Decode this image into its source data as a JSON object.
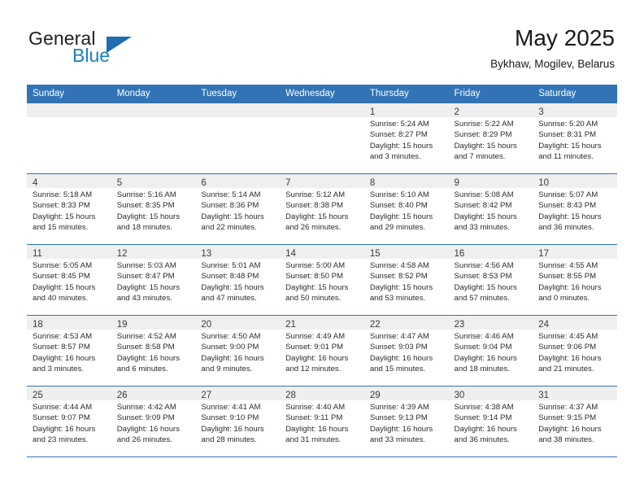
{
  "brand": {
    "word_one": "General",
    "word_two": "Blue",
    "triangle_color": "#1f6cb0",
    "blue_text_color": "#1a7fc1"
  },
  "header": {
    "month_title": "May 2025",
    "location": "Bykhaw, Mogilev, Belarus"
  },
  "theme": {
    "header_row_bg": "#3273b5",
    "header_row_text": "#ffffff",
    "daynum_strip_bg": "#efefef",
    "grid_line": "#3273b5"
  },
  "calendar": {
    "weekday_headers": [
      "Sunday",
      "Monday",
      "Tuesday",
      "Wednesday",
      "Thursday",
      "Friday",
      "Saturday"
    ],
    "weeks": [
      [
        {
          "day": "",
          "empty": true
        },
        {
          "day": "",
          "empty": true
        },
        {
          "day": "",
          "empty": true
        },
        {
          "day": "",
          "empty": true
        },
        {
          "day": "1",
          "sunrise": "Sunrise: 5:24 AM",
          "sunset": "Sunset: 8:27 PM",
          "daylight_1": "Daylight: 15 hours",
          "daylight_2": "and 3 minutes."
        },
        {
          "day": "2",
          "sunrise": "Sunrise: 5:22 AM",
          "sunset": "Sunset: 8:29 PM",
          "daylight_1": "Daylight: 15 hours",
          "daylight_2": "and 7 minutes."
        },
        {
          "day": "3",
          "sunrise": "Sunrise: 5:20 AM",
          "sunset": "Sunset: 8:31 PM",
          "daylight_1": "Daylight: 15 hours",
          "daylight_2": "and 11 minutes."
        }
      ],
      [
        {
          "day": "4",
          "sunrise": "Sunrise: 5:18 AM",
          "sunset": "Sunset: 8:33 PM",
          "daylight_1": "Daylight: 15 hours",
          "daylight_2": "and 15 minutes."
        },
        {
          "day": "5",
          "sunrise": "Sunrise: 5:16 AM",
          "sunset": "Sunset: 8:35 PM",
          "daylight_1": "Daylight: 15 hours",
          "daylight_2": "and 18 minutes."
        },
        {
          "day": "6",
          "sunrise": "Sunrise: 5:14 AM",
          "sunset": "Sunset: 8:36 PM",
          "daylight_1": "Daylight: 15 hours",
          "daylight_2": "and 22 minutes."
        },
        {
          "day": "7",
          "sunrise": "Sunrise: 5:12 AM",
          "sunset": "Sunset: 8:38 PM",
          "daylight_1": "Daylight: 15 hours",
          "daylight_2": "and 26 minutes."
        },
        {
          "day": "8",
          "sunrise": "Sunrise: 5:10 AM",
          "sunset": "Sunset: 8:40 PM",
          "daylight_1": "Daylight: 15 hours",
          "daylight_2": "and 29 minutes."
        },
        {
          "day": "9",
          "sunrise": "Sunrise: 5:08 AM",
          "sunset": "Sunset: 8:42 PM",
          "daylight_1": "Daylight: 15 hours",
          "daylight_2": "and 33 minutes."
        },
        {
          "day": "10",
          "sunrise": "Sunrise: 5:07 AM",
          "sunset": "Sunset: 8:43 PM",
          "daylight_1": "Daylight: 15 hours",
          "daylight_2": "and 36 minutes."
        }
      ],
      [
        {
          "day": "11",
          "sunrise": "Sunrise: 5:05 AM",
          "sunset": "Sunset: 8:45 PM",
          "daylight_1": "Daylight: 15 hours",
          "daylight_2": "and 40 minutes."
        },
        {
          "day": "12",
          "sunrise": "Sunrise: 5:03 AM",
          "sunset": "Sunset: 8:47 PM",
          "daylight_1": "Daylight: 15 hours",
          "daylight_2": "and 43 minutes."
        },
        {
          "day": "13",
          "sunrise": "Sunrise: 5:01 AM",
          "sunset": "Sunset: 8:48 PM",
          "daylight_1": "Daylight: 15 hours",
          "daylight_2": "and 47 minutes."
        },
        {
          "day": "14",
          "sunrise": "Sunrise: 5:00 AM",
          "sunset": "Sunset: 8:50 PM",
          "daylight_1": "Daylight: 15 hours",
          "daylight_2": "and 50 minutes."
        },
        {
          "day": "15",
          "sunrise": "Sunrise: 4:58 AM",
          "sunset": "Sunset: 8:52 PM",
          "daylight_1": "Daylight: 15 hours",
          "daylight_2": "and 53 minutes."
        },
        {
          "day": "16",
          "sunrise": "Sunrise: 4:56 AM",
          "sunset": "Sunset: 8:53 PM",
          "daylight_1": "Daylight: 15 hours",
          "daylight_2": "and 57 minutes."
        },
        {
          "day": "17",
          "sunrise": "Sunrise: 4:55 AM",
          "sunset": "Sunset: 8:55 PM",
          "daylight_1": "Daylight: 16 hours",
          "daylight_2": "and 0 minutes."
        }
      ],
      [
        {
          "day": "18",
          "sunrise": "Sunrise: 4:53 AM",
          "sunset": "Sunset: 8:57 PM",
          "daylight_1": "Daylight: 16 hours",
          "daylight_2": "and 3 minutes."
        },
        {
          "day": "19",
          "sunrise": "Sunrise: 4:52 AM",
          "sunset": "Sunset: 8:58 PM",
          "daylight_1": "Daylight: 16 hours",
          "daylight_2": "and 6 minutes."
        },
        {
          "day": "20",
          "sunrise": "Sunrise: 4:50 AM",
          "sunset": "Sunset: 9:00 PM",
          "daylight_1": "Daylight: 16 hours",
          "daylight_2": "and 9 minutes."
        },
        {
          "day": "21",
          "sunrise": "Sunrise: 4:49 AM",
          "sunset": "Sunset: 9:01 PM",
          "daylight_1": "Daylight: 16 hours",
          "daylight_2": "and 12 minutes."
        },
        {
          "day": "22",
          "sunrise": "Sunrise: 4:47 AM",
          "sunset": "Sunset: 9:03 PM",
          "daylight_1": "Daylight: 16 hours",
          "daylight_2": "and 15 minutes."
        },
        {
          "day": "23",
          "sunrise": "Sunrise: 4:46 AM",
          "sunset": "Sunset: 9:04 PM",
          "daylight_1": "Daylight: 16 hours",
          "daylight_2": "and 18 minutes."
        },
        {
          "day": "24",
          "sunrise": "Sunrise: 4:45 AM",
          "sunset": "Sunset: 9:06 PM",
          "daylight_1": "Daylight: 16 hours",
          "daylight_2": "and 21 minutes."
        }
      ],
      [
        {
          "day": "25",
          "sunrise": "Sunrise: 4:44 AM",
          "sunset": "Sunset: 9:07 PM",
          "daylight_1": "Daylight: 16 hours",
          "daylight_2": "and 23 minutes."
        },
        {
          "day": "26",
          "sunrise": "Sunrise: 4:42 AM",
          "sunset": "Sunset: 9:09 PM",
          "daylight_1": "Daylight: 16 hours",
          "daylight_2": "and 26 minutes."
        },
        {
          "day": "27",
          "sunrise": "Sunrise: 4:41 AM",
          "sunset": "Sunset: 9:10 PM",
          "daylight_1": "Daylight: 16 hours",
          "daylight_2": "and 28 minutes."
        },
        {
          "day": "28",
          "sunrise": "Sunrise: 4:40 AM",
          "sunset": "Sunset: 9:11 PM",
          "daylight_1": "Daylight: 16 hours",
          "daylight_2": "and 31 minutes."
        },
        {
          "day": "29",
          "sunrise": "Sunrise: 4:39 AM",
          "sunset": "Sunset: 9:13 PM",
          "daylight_1": "Daylight: 16 hours",
          "daylight_2": "and 33 minutes."
        },
        {
          "day": "30",
          "sunrise": "Sunrise: 4:38 AM",
          "sunset": "Sunset: 9:14 PM",
          "daylight_1": "Daylight: 16 hours",
          "daylight_2": "and 36 minutes."
        },
        {
          "day": "31",
          "sunrise": "Sunrise: 4:37 AM",
          "sunset": "Sunset: 9:15 PM",
          "daylight_1": "Daylight: 16 hours",
          "daylight_2": "and 38 minutes."
        }
      ]
    ]
  }
}
